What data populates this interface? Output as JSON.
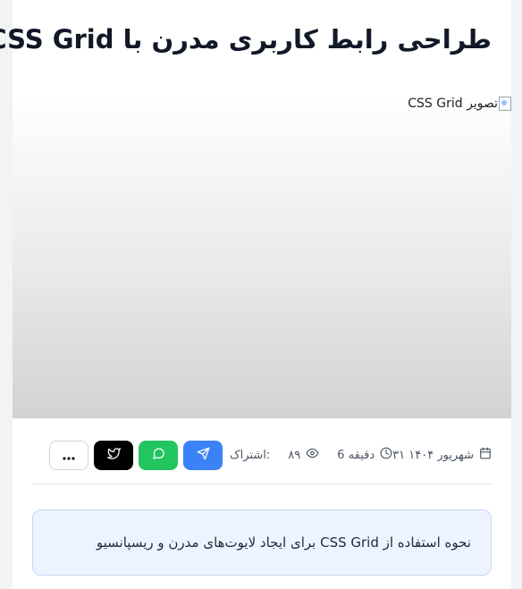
{
  "article": {
    "title": "طراحی رابط کاربری مدرن با CSS Grid",
    "image_alt": "تصویر CSS Grid",
    "date": "۳۱ شهریور ۱۴۰۴",
    "read_time": "6 دقیقه",
    "views": "۸۹",
    "share_label": "اشتراک:",
    "summary": "نحوه استفاده از CSS Grid برای ایجاد لایوت‌های مدرن و ریسپانسیو"
  },
  "icons": {
    "date": "calendar-icon",
    "read_time": "clock-icon",
    "views": "eye-icon",
    "telegram": "send-icon",
    "whatsapp": "chat-bubble-icon",
    "twitter": "twitter-bird-icon",
    "more": "ellipsis-icon"
  },
  "colors": {
    "telegram": "#3b82f6",
    "whatsapp": "#22c55e",
    "twitter": "#000000",
    "summary_bg": "#eef4ff"
  }
}
